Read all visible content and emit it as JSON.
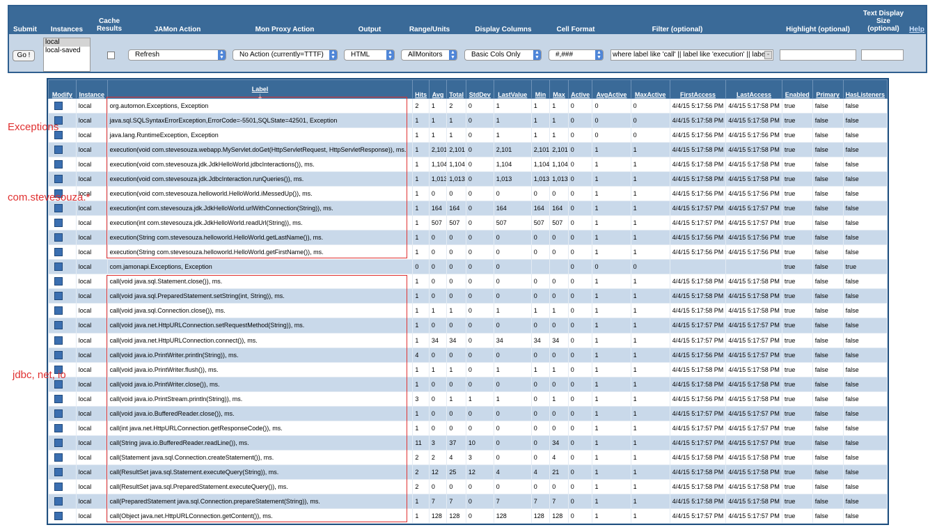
{
  "controls": {
    "headers": {
      "submit": "Submit",
      "instances": "Instances",
      "cache_results": "Cache Results",
      "jamon_action": "JAMon Action",
      "mon_proxy_action": "Mon Proxy Action",
      "output": "Output",
      "range_units": "Range/Units",
      "display_columns": "Display Columns",
      "cell_format": "Cell Format",
      "filter": "Filter (optional)",
      "highlight": "Highlight (optional)",
      "text_display_size": "Text Display Size (optional)",
      "help": "Help"
    },
    "go_label": "Go !",
    "instances": [
      "local",
      "local-saved"
    ],
    "jamon_action": "Refresh",
    "mon_proxy_action": "No Action (currently=TTTF)",
    "output": "HTML",
    "range_units": "AllMonitors",
    "display_columns": "Basic Cols Only",
    "cell_format": "#,###",
    "filter_value": "where label like 'call' || label like 'execution' || label",
    "highlight_value": "",
    "text_display_size_value": ""
  },
  "table": {
    "columns": [
      "Modify",
      "Instance",
      "Label",
      "Hits",
      "Avg",
      "Total",
      "StdDev",
      "LastValue",
      "Min",
      "Max",
      "Active",
      "AvgActive",
      "MaxActive",
      "FirstAccess",
      "LastAccess",
      "Enabled",
      "Primary",
      "HasListeners"
    ],
    "sort_arrow": "↓",
    "rows": [
      [
        "local",
        "org.automon.Exceptions, Exception",
        "2",
        "1",
        "2",
        "0",
        "1",
        "1",
        "1",
        "0",
        "0",
        "0",
        "4/4/15 5:17:56 PM",
        "4/4/15 5:17:58 PM",
        "true",
        "false",
        "false"
      ],
      [
        "local",
        "java.sql.SQLSyntaxErrorException,ErrorCode=-5501,SQLState=42501, Exception",
        "1",
        "1",
        "1",
        "0",
        "1",
        "1",
        "1",
        "0",
        "0",
        "0",
        "4/4/15 5:17:58 PM",
        "4/4/15 5:17:58 PM",
        "true",
        "false",
        "false"
      ],
      [
        "local",
        "java.lang.RuntimeException, Exception",
        "1",
        "1",
        "1",
        "0",
        "1",
        "1",
        "1",
        "0",
        "0",
        "0",
        "4/4/15 5:17:56 PM",
        "4/4/15 5:17:56 PM",
        "true",
        "false",
        "false"
      ],
      [
        "local",
        "execution(void com.stevesouza.webapp.MyServlet.doGet(HttpServletRequest, HttpServletResponse)), ms.",
        "1",
        "2,101",
        "2,101",
        "0",
        "2,101",
        "2,101",
        "2,101",
        "0",
        "1",
        "1",
        "4/4/15 5:17:58 PM",
        "4/4/15 5:17:58 PM",
        "true",
        "false",
        "false"
      ],
      [
        "local",
        "execution(void com.stevesouza.jdk.JdkHelloWorld.jdbcInteractions()), ms.",
        "1",
        "1,104",
        "1,104",
        "0",
        "1,104",
        "1,104",
        "1,104",
        "0",
        "1",
        "1",
        "4/4/15 5:17:58 PM",
        "4/4/15 5:17:58 PM",
        "true",
        "false",
        "false"
      ],
      [
        "local",
        "execution(void com.stevesouza.jdk.JdbcInteraction.runQueries()), ms.",
        "1",
        "1,013",
        "1,013",
        "0",
        "1,013",
        "1,013",
        "1,013",
        "0",
        "1",
        "1",
        "4/4/15 5:17:58 PM",
        "4/4/15 5:17:58 PM",
        "true",
        "false",
        "false"
      ],
      [
        "local",
        "execution(void com.stevesouza.helloworld.HelloWorld.iMessedUp()), ms.",
        "1",
        "0",
        "0",
        "0",
        "0",
        "0",
        "0",
        "0",
        "1",
        "1",
        "4/4/15 5:17:56 PM",
        "4/4/15 5:17:56 PM",
        "true",
        "false",
        "false"
      ],
      [
        "local",
        "execution(int com.stevesouza.jdk.JdkHelloWorld.urlWithConnection(String)), ms.",
        "1",
        "164",
        "164",
        "0",
        "164",
        "164",
        "164",
        "0",
        "1",
        "1",
        "4/4/15 5:17:57 PM",
        "4/4/15 5:17:57 PM",
        "true",
        "false",
        "false"
      ],
      [
        "local",
        "execution(int com.stevesouza.jdk.JdkHelloWorld.readUrl(String)), ms.",
        "1",
        "507",
        "507",
        "0",
        "507",
        "507",
        "507",
        "0",
        "1",
        "1",
        "4/4/15 5:17:57 PM",
        "4/4/15 5:17:57 PM",
        "true",
        "false",
        "false"
      ],
      [
        "local",
        "execution(String com.stevesouza.helloworld.HelloWorld.getLastName()), ms.",
        "1",
        "0",
        "0",
        "0",
        "0",
        "0",
        "0",
        "0",
        "1",
        "1",
        "4/4/15 5:17:56 PM",
        "4/4/15 5:17:56 PM",
        "true",
        "false",
        "false"
      ],
      [
        "local",
        "execution(String com.stevesouza.helloworld.HelloWorld.getFirstName()), ms.",
        "1",
        "0",
        "0",
        "0",
        "0",
        "0",
        "0",
        "0",
        "1",
        "1",
        "4/4/15 5:17:56 PM",
        "4/4/15 5:17:56 PM",
        "true",
        "false",
        "false"
      ],
      [
        "local",
        "com.jamonapi.Exceptions, Exception",
        "0",
        "0",
        "0",
        "0",
        "0",
        "",
        "",
        "0",
        "0",
        "0",
        "",
        "",
        "true",
        "false",
        "true"
      ],
      [
        "local",
        "call(void java.sql.Statement.close()), ms.",
        "1",
        "0",
        "0",
        "0",
        "0",
        "0",
        "0",
        "0",
        "1",
        "1",
        "4/4/15 5:17:58 PM",
        "4/4/15 5:17:58 PM",
        "true",
        "false",
        "false"
      ],
      [
        "local",
        "call(void java.sql.PreparedStatement.setString(int, String)), ms.",
        "1",
        "0",
        "0",
        "0",
        "0",
        "0",
        "0",
        "0",
        "1",
        "1",
        "4/4/15 5:17:58 PM",
        "4/4/15 5:17:58 PM",
        "true",
        "false",
        "false"
      ],
      [
        "local",
        "call(void java.sql.Connection.close()), ms.",
        "1",
        "1",
        "1",
        "0",
        "1",
        "1",
        "1",
        "0",
        "1",
        "1",
        "4/4/15 5:17:58 PM",
        "4/4/15 5:17:58 PM",
        "true",
        "false",
        "false"
      ],
      [
        "local",
        "call(void java.net.HttpURLConnection.setRequestMethod(String)), ms.",
        "1",
        "0",
        "0",
        "0",
        "0",
        "0",
        "0",
        "0",
        "1",
        "1",
        "4/4/15 5:17:57 PM",
        "4/4/15 5:17:57 PM",
        "true",
        "false",
        "false"
      ],
      [
        "local",
        "call(void java.net.HttpURLConnection.connect()), ms.",
        "1",
        "34",
        "34",
        "0",
        "34",
        "34",
        "34",
        "0",
        "1",
        "1",
        "4/4/15 5:17:57 PM",
        "4/4/15 5:17:57 PM",
        "true",
        "false",
        "false"
      ],
      [
        "local",
        "call(void java.io.PrintWriter.println(String)), ms.",
        "4",
        "0",
        "0",
        "0",
        "0",
        "0",
        "0",
        "0",
        "1",
        "1",
        "4/4/15 5:17:56 PM",
        "4/4/15 5:17:57 PM",
        "true",
        "false",
        "false"
      ],
      [
        "local",
        "call(void java.io.PrintWriter.flush()), ms.",
        "1",
        "1",
        "1",
        "0",
        "1",
        "1",
        "1",
        "0",
        "1",
        "1",
        "4/4/15 5:17:58 PM",
        "4/4/15 5:17:58 PM",
        "true",
        "false",
        "false"
      ],
      [
        "local",
        "call(void java.io.PrintWriter.close()), ms.",
        "1",
        "0",
        "0",
        "0",
        "0",
        "0",
        "0",
        "0",
        "1",
        "1",
        "4/4/15 5:17:58 PM",
        "4/4/15 5:17:58 PM",
        "true",
        "false",
        "false"
      ],
      [
        "local",
        "call(void java.io.PrintStream.println(String)), ms.",
        "3",
        "0",
        "1",
        "1",
        "1",
        "0",
        "1",
        "0",
        "1",
        "1",
        "4/4/15 5:17:56 PM",
        "4/4/15 5:17:58 PM",
        "true",
        "false",
        "false"
      ],
      [
        "local",
        "call(void java.io.BufferedReader.close()), ms.",
        "1",
        "0",
        "0",
        "0",
        "0",
        "0",
        "0",
        "0",
        "1",
        "1",
        "4/4/15 5:17:57 PM",
        "4/4/15 5:17:57 PM",
        "true",
        "false",
        "false"
      ],
      [
        "local",
        "call(int java.net.HttpURLConnection.getResponseCode()), ms.",
        "1",
        "0",
        "0",
        "0",
        "0",
        "0",
        "0",
        "0",
        "1",
        "1",
        "4/4/15 5:17:57 PM",
        "4/4/15 5:17:57 PM",
        "true",
        "false",
        "false"
      ],
      [
        "local",
        "call(String java.io.BufferedReader.readLine()), ms.",
        "11",
        "3",
        "37",
        "10",
        "0",
        "0",
        "34",
        "0",
        "1",
        "1",
        "4/4/15 5:17:57 PM",
        "4/4/15 5:17:57 PM",
        "true",
        "false",
        "false"
      ],
      [
        "local",
        "call(Statement java.sql.Connection.createStatement()), ms.",
        "2",
        "2",
        "4",
        "3",
        "0",
        "0",
        "4",
        "0",
        "1",
        "1",
        "4/4/15 5:17:58 PM",
        "4/4/15 5:17:58 PM",
        "true",
        "false",
        "false"
      ],
      [
        "local",
        "call(ResultSet java.sql.Statement.executeQuery(String)), ms.",
        "2",
        "12",
        "25",
        "12",
        "4",
        "4",
        "21",
        "0",
        "1",
        "1",
        "4/4/15 5:17:58 PM",
        "4/4/15 5:17:58 PM",
        "true",
        "false",
        "false"
      ],
      [
        "local",
        "call(ResultSet java.sql.PreparedStatement.executeQuery()), ms.",
        "2",
        "0",
        "0",
        "0",
        "0",
        "0",
        "0",
        "0",
        "1",
        "1",
        "4/4/15 5:17:58 PM",
        "4/4/15 5:17:58 PM",
        "true",
        "false",
        "false"
      ],
      [
        "local",
        "call(PreparedStatement java.sql.Connection.prepareStatement(String)), ms.",
        "1",
        "7",
        "7",
        "0",
        "7",
        "7",
        "7",
        "0",
        "1",
        "1",
        "4/4/15 5:17:58 PM",
        "4/4/15 5:17:58 PM",
        "true",
        "false",
        "false"
      ],
      [
        "local",
        "call(Object java.net.HttpURLConnection.getContent()), ms.",
        "1",
        "128",
        "128",
        "0",
        "128",
        "128",
        "128",
        "0",
        "1",
        "1",
        "4/4/15 5:17:57 PM",
        "4/4/15 5:17:57 PM",
        "true",
        "false",
        "false"
      ]
    ]
  },
  "annotations": {
    "exceptions": "Exceptions",
    "stevesouza": "com.stevesouza.*",
    "jdbc_net_io": "jdbc, net, io"
  },
  "colors": {
    "header_blue": "#3a6a98",
    "row_alt": "#c9d9ea",
    "annotation_red": "#e03030"
  }
}
